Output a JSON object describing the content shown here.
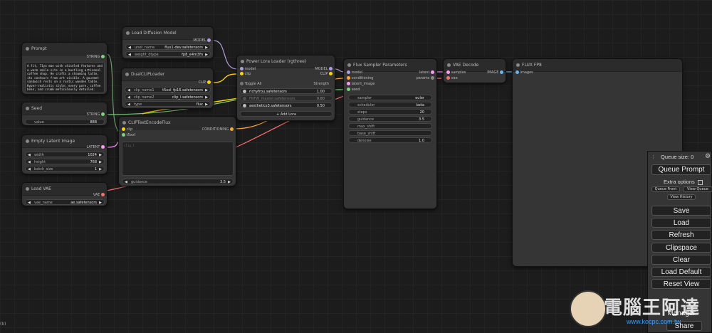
{
  "nodes": {
    "prompt": {
      "title": "Prompt",
      "out": "STRING",
      "text": "A fit, 71yo man with chiseled features and a warm smile sits in a bustling artisanal coffee shop. He crafts a steaming latte, its contours from art visible. A gourmet sandwich rests on a rustic wooden table. Hyper-realistic style; every pore, coffee bean, and crumb meticulously detailed."
    },
    "seed": {
      "title": "Seed",
      "out": "STRING",
      "widget_label": "value",
      "widget_value": "888"
    },
    "empty_latent": {
      "title": "Empty Latent Image",
      "out": "LATENT",
      "width_label": "width",
      "width_value": "1024",
      "height_label": "height",
      "height_value": "768",
      "batch_label": "batch_size",
      "batch_value": "1"
    },
    "load_vae": {
      "title": "Load VAE",
      "out": "VAE",
      "name_label": "vae_name",
      "name_value": "ae.safetensors"
    },
    "load_diffusion": {
      "title": "Load Diffusion Model",
      "out": "MODEL",
      "unet_label": "unet_name",
      "unet_value": "flux1-dev.safetensors",
      "dtype_label": "weight_dtype",
      "dtype_value": "fp8_e4m3fn"
    },
    "dual_clip": {
      "title": "DualCLIPLoader",
      "out": "CLIP",
      "clip1_label": "clip_name1",
      "clip1_value": "t5xxl_fp16.safetensors",
      "clip2_label": "clip_name2",
      "clip2_value": "clip_l.safetensors",
      "type_label": "type",
      "type_value": "flux"
    },
    "clip_encode": {
      "title": "CLIPTextEncodeFlux",
      "in_clip": "clip",
      "in_t5": "t5xxl",
      "out": "CONDITIONING",
      "placeholder": "clip_l",
      "guidance_label": "guidance",
      "guidance_value": "3.5"
    },
    "lora": {
      "title": "Power Lora Loader (rgthree)",
      "in_model": "model",
      "in_clip": "clip",
      "out_model": "MODEL",
      "out_clip": "CLIP",
      "toggle_label": "Toggle All",
      "strength_label": "Strength",
      "loras": [
        {
          "name": "richyfrou.safetensors",
          "strength": "1.00"
        },
        {
          "name": "FRFW_master.safetensors",
          "strength": "0.80"
        },
        {
          "name": "aesthetics3.safetensors",
          "strength": "0.50"
        }
      ],
      "add_label": "Add Lora"
    },
    "sampler": {
      "title": "Flux Sampler Parameters",
      "in": [
        "model",
        "conditioning",
        "latent_image",
        "seed"
      ],
      "out_latent": "latent",
      "out_params": "params",
      "widgets": [
        {
          "label": "sampler",
          "value": "euler"
        },
        {
          "label": "scheduler",
          "value": "beta"
        },
        {
          "label": "steps",
          "value": "20"
        },
        {
          "label": "guidance",
          "value": "3.5"
        },
        {
          "label": "max_shift",
          "value": ""
        },
        {
          "label": "base_shift",
          "value": ""
        },
        {
          "label": "denoise",
          "value": "1.0"
        }
      ]
    },
    "vae_decode": {
      "title": "VAE Decode",
      "in_samples": "samples",
      "in_vae": "vae",
      "out": "IMAGE"
    },
    "flux_fp8": {
      "title": "FLUX FP8",
      "in": "images"
    }
  },
  "menu": {
    "queue_size": "Queue size: 0",
    "queue_prompt": "Queue Prompt",
    "extra_options": "Extra options",
    "queue_front": "Queue Front",
    "view_queue": "View Queue",
    "view_history": "View History",
    "buttons": [
      "Save",
      "Load",
      "Refresh",
      "Clipspace",
      "Clear",
      "Load Default",
      "Reset View"
    ],
    "manager": "Manager",
    "share": "Share"
  },
  "watermark": "電腦王阿達",
  "watermark_url": "www.kocpc.com.tw",
  "corner_text": "(b)",
  "colors": {
    "model": "#b39ddb",
    "clip": "#ffd500",
    "conditioning": "#ffa931",
    "latent": "#ff9cf9",
    "vae": "#ff6e6e",
    "image": "#64b5f6",
    "string": "#7fd17f",
    "int": "#7fd17f"
  }
}
